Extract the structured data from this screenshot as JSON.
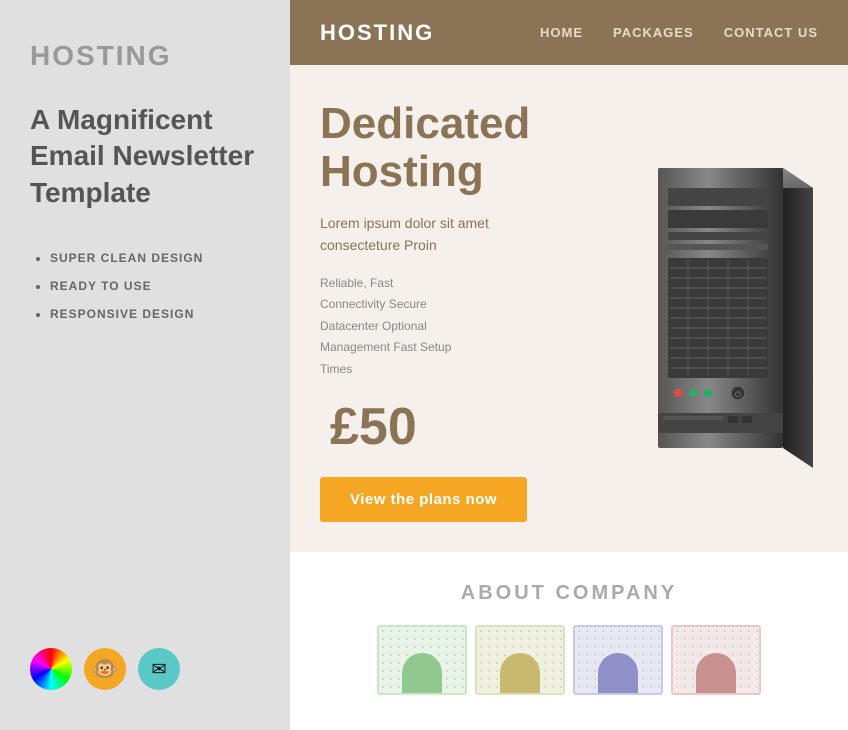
{
  "sidebar": {
    "title": "HOSTING",
    "subtitle": "A Magnificent Email Newsletter Template",
    "features": [
      "SUPER CLEAN DESIGN",
      "READY TO USE",
      "RESPONSIVE DESIGN"
    ],
    "icons": [
      {
        "name": "colorwheel-icon",
        "type": "colorwheel"
      },
      {
        "name": "mailchimp-icon",
        "type": "chimp"
      },
      {
        "name": "email-icon",
        "type": "mail"
      }
    ]
  },
  "navbar": {
    "brand": "HOSTING",
    "links": [
      {
        "label": "HOME"
      },
      {
        "label": "PACKAGES"
      },
      {
        "label": "CONTACT US"
      }
    ]
  },
  "hero": {
    "heading_line1": "Dedicated",
    "heading_line2": "Hosting",
    "description_line1": "Lorem ipsum dolor sit amet",
    "description_line2": "consecteture Proin",
    "features_text": "Reliable, Fast\nConnectivity Secure\nDatacenter Optional\nManagement Fast Setup\nTimes",
    "price": "£50",
    "cta_label": "View the plans now"
  },
  "about": {
    "title": "ABOUT COMPANY"
  }
}
